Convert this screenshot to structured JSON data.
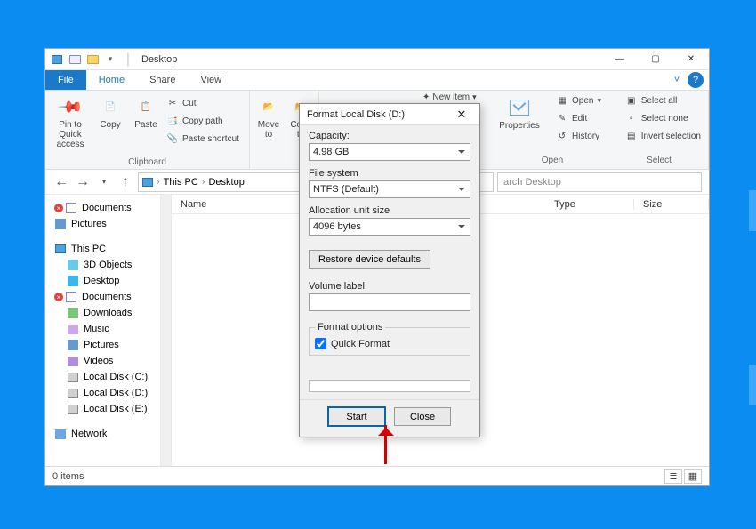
{
  "window": {
    "title": "Desktop",
    "tabs": {
      "file": "File",
      "home": "Home",
      "share": "Share",
      "view": "View"
    }
  },
  "ribbon": {
    "clipboard": {
      "label": "Clipboard",
      "pin": "Pin to Quick access",
      "copy": "Copy",
      "paste": "Paste",
      "cut": "Cut",
      "copy_path": "Copy path",
      "paste_shortcut": "Paste shortcut"
    },
    "organize": {
      "move": "Move to",
      "copy": "Copy to"
    },
    "new": {
      "new_item": "New item"
    },
    "open": {
      "label": "Open",
      "properties": "Properties",
      "open": "Open",
      "edit": "Edit",
      "history": "History"
    },
    "select": {
      "label": "Select",
      "all": "Select all",
      "none": "Select none",
      "invert": "Invert selection"
    }
  },
  "nav": {
    "breadcrumb": [
      "This PC",
      "Desktop"
    ],
    "search_placeholder": "arch Desktop"
  },
  "tree": {
    "quick": [
      {
        "label": "Documents",
        "icon": "docs",
        "badge": true
      },
      {
        "label": "Pictures",
        "icon": "pics"
      }
    ],
    "thispc_label": "This PC",
    "thispc": [
      {
        "label": "3D Objects",
        "icon": "3d"
      },
      {
        "label": "Desktop",
        "icon": "desk"
      },
      {
        "label": "Documents",
        "icon": "docs",
        "badge": true
      },
      {
        "label": "Downloads",
        "icon": "dl"
      },
      {
        "label": "Music",
        "icon": "mus"
      },
      {
        "label": "Pictures",
        "icon": "pics"
      },
      {
        "label": "Videos",
        "icon": "vid"
      },
      {
        "label": "Local Disk (C:)",
        "icon": "disk"
      },
      {
        "label": "Local Disk (D:)",
        "icon": "disk"
      },
      {
        "label": "Local Disk (E:)",
        "icon": "disk"
      }
    ],
    "network_label": "Network"
  },
  "columns": {
    "name": "Name",
    "date": "",
    "type": "Type",
    "size": "Size"
  },
  "status": {
    "items": "0 items"
  },
  "dialog": {
    "title": "Format Local Disk (D:)",
    "capacity_label": "Capacity:",
    "capacity_value": "4.98 GB",
    "fs_label": "File system",
    "fs_value": "NTFS (Default)",
    "alloc_label": "Allocation unit size",
    "alloc_value": "4096 bytes",
    "restore": "Restore device defaults",
    "volume_label": "Volume label",
    "volume_value": "",
    "options_legend": "Format options",
    "quick_format": "Quick Format",
    "start": "Start",
    "close": "Close"
  }
}
